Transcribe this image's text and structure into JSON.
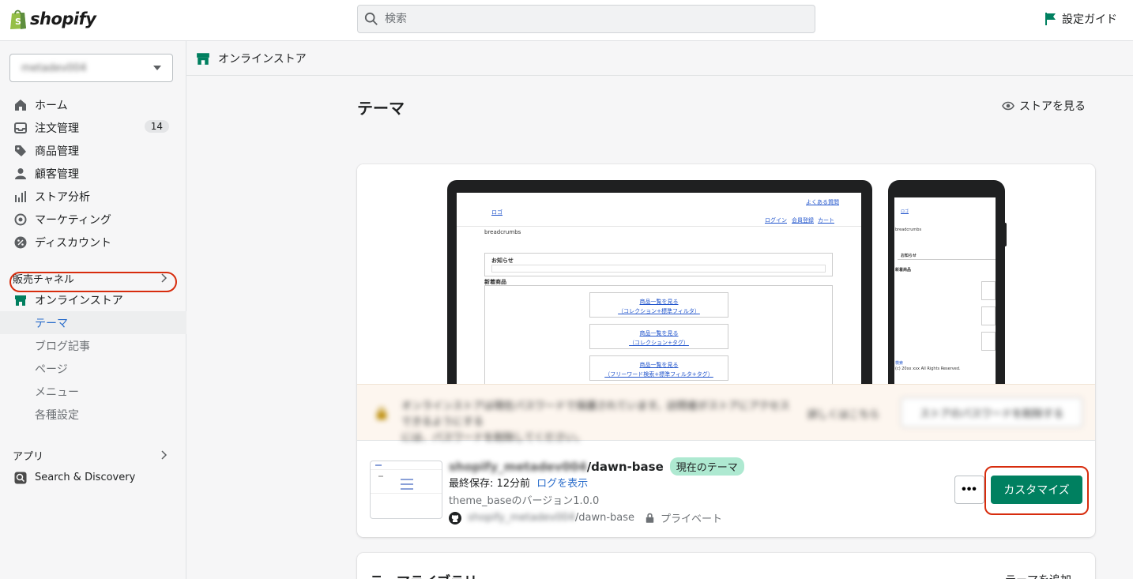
{
  "topbar": {
    "logo_text": "shopify",
    "search_placeholder": "検索",
    "setup_guide": "設定ガイド"
  },
  "sidebar": {
    "store_name": "metadev004",
    "items": [
      {
        "label": "ホーム",
        "icon": "home-icon"
      },
      {
        "label": "注文管理",
        "icon": "inbox-icon",
        "badge": "14"
      },
      {
        "label": "商品管理",
        "icon": "tag-icon"
      },
      {
        "label": "顧客管理",
        "icon": "person-icon"
      },
      {
        "label": "ストア分析",
        "icon": "bar-chart-icon"
      },
      {
        "label": "マーケティング",
        "icon": "target-icon"
      },
      {
        "label": "ディスカウント",
        "icon": "discount-icon"
      }
    ],
    "sales_channels_label": "販売チャネル",
    "online_store": "オンラインストア",
    "sub_items": [
      "テーマ",
      "ブログ記事",
      "ページ",
      "メニュー",
      "各種設定"
    ],
    "apps_label": "アプリ",
    "app_item": "Search & Discovery"
  },
  "breadcrumb": {
    "label": "オンラインストア"
  },
  "page": {
    "title": "テーマ",
    "view_store": "ストアを見る"
  },
  "preview": {
    "laptop": {
      "faq": "よくある質問",
      "logo": "ロゴ",
      "login": "ログイン",
      "register": "会員登録",
      "cart": "カート",
      "breadcrumbs": "breadcrumbs",
      "notice": "お知らせ",
      "new_products": "新着商品",
      "buttons": [
        {
          "line1": "商品一覧を見る",
          "line2": "（コレクション+標準フィルタ）"
        },
        {
          "line1": "商品一覧を見る",
          "line2": "（コレクション+タグ）"
        },
        {
          "line1": "商品一覧を見る",
          "line2": "（フリーワード検索+標準フィルタ+タグ）"
        }
      ]
    },
    "phone": {
      "logo": "ロゴ",
      "breadcrumbs": "breadcrumbs",
      "notice": "お知らせ",
      "new_products": "新着商品",
      "search": "検索",
      "copyright": "(c) 20xx xxx All Rights Reserved."
    }
  },
  "banner": {
    "text_line1": "オンラインストアは現在パスワードで保護されています。訪問者がストアにアクセスできるようにする",
    "text_line2": "には、パスワードを削除してください。",
    "link": "詳しくはこちら",
    "button": "ストアのパスワードを削除する"
  },
  "theme": {
    "owner": "shopify_metadev004",
    "name": "/dawn-base",
    "current_badge": "現在のテーマ",
    "last_saved": "最終保存: 12分前",
    "view_log": "ログを表示",
    "version": "theme_baseのバージョン1.0.0",
    "repo_owner": "shopify_metadev004",
    "repo_name": "/dawn-base",
    "visibility": "プライベート",
    "more_label": "•••",
    "customize": "カスタマイズ"
  },
  "library": {
    "title": "テーマライブラリ",
    "add_theme": "テーマを追加"
  },
  "colors": {
    "primary": "#008060",
    "badge_bg": "#aee9d1",
    "highlight": "#d72c0d",
    "link": "#2c6ecb"
  }
}
